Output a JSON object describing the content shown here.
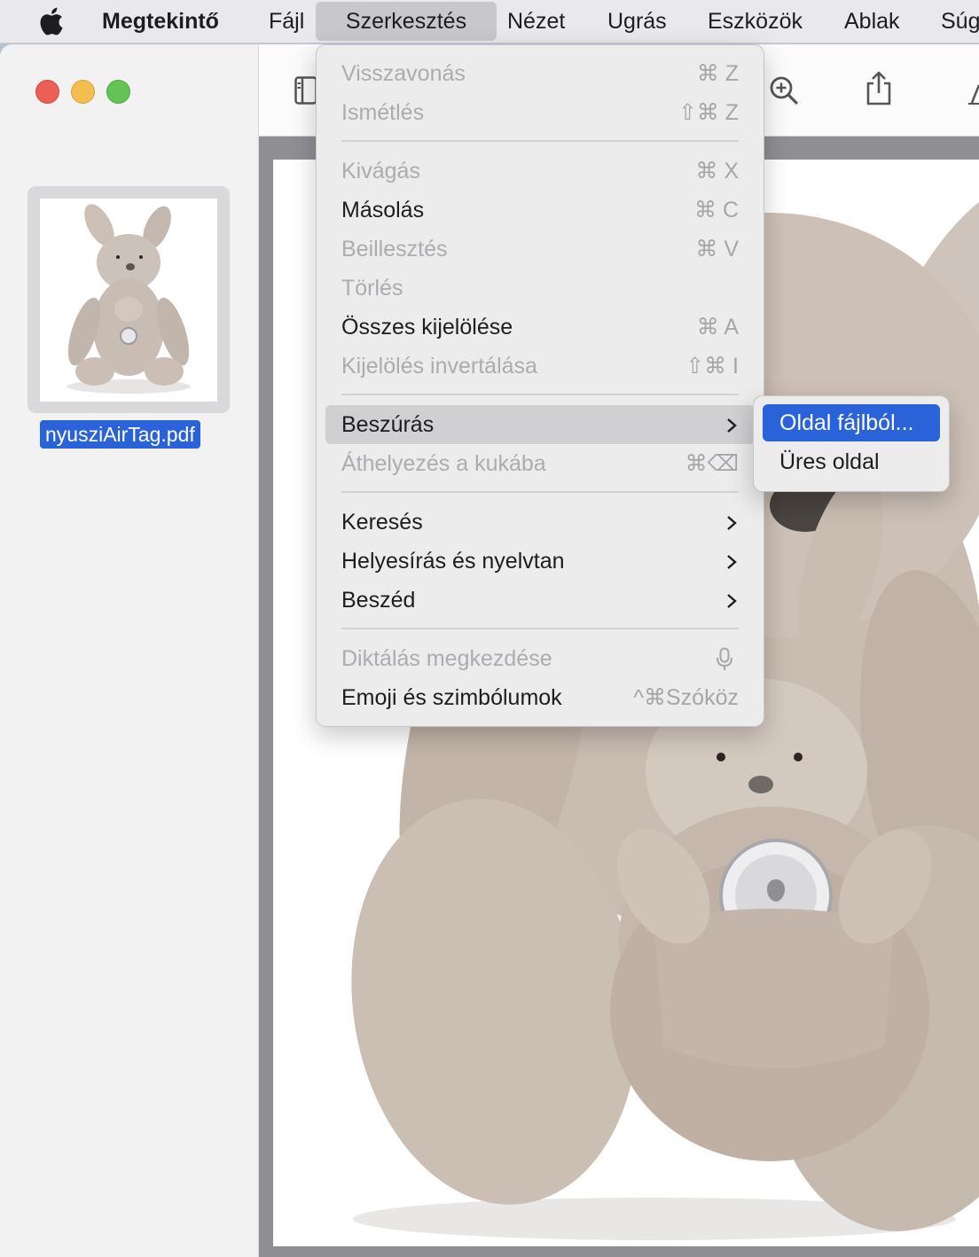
{
  "menubar": {
    "app": "Megtekintő",
    "items": [
      "Fájl",
      "Szerkesztés",
      "Nézet",
      "Ugrás",
      "Eszközök",
      "Ablak",
      "Súg"
    ],
    "active": "Szerkesztés"
  },
  "sidebar": {
    "filename": "nyusziAirTag.pdf"
  },
  "edit_menu": {
    "items": [
      {
        "label": "Visszavonás",
        "shortcut": "⌘ Z",
        "enabled": false
      },
      {
        "label": "Ismétlés",
        "shortcut": "⇧⌘ Z",
        "enabled": false
      },
      {
        "label": "Kivágás",
        "shortcut": "⌘ X",
        "enabled": false
      },
      {
        "label": "Másolás",
        "shortcut": "⌘ C",
        "enabled": true
      },
      {
        "label": "Beillesztés",
        "shortcut": "⌘ V",
        "enabled": false
      },
      {
        "label": "Törlés",
        "shortcut": "",
        "enabled": false
      },
      {
        "label": "Összes kijelölése",
        "shortcut": "⌘ A",
        "enabled": true
      },
      {
        "label": "Kijelölés invertálása",
        "shortcut": "⇧⌘ I",
        "enabled": false
      },
      {
        "label": "Beszúrás",
        "submenu": true,
        "enabled": true,
        "highlighted": true
      },
      {
        "label": "Áthelyezés a kukába",
        "shortcut": "⌘⌫",
        "enabled": false
      },
      {
        "label": "Keresés",
        "submenu": true,
        "enabled": true
      },
      {
        "label": "Helyesírás és nyelvtan",
        "submenu": true,
        "enabled": true
      },
      {
        "label": "Beszéd",
        "submenu": true,
        "enabled": true
      },
      {
        "label": "Diktálás megkezdése",
        "icon": "microphone-icon",
        "enabled": false
      },
      {
        "label": "Emoji és szimbólumok",
        "shortcut": "^⌘Szóköz",
        "enabled": true
      }
    ]
  },
  "insert_submenu": {
    "items": [
      {
        "label": "Oldal fájlból...",
        "selected": true
      },
      {
        "label": "Üres oldal",
        "selected": false
      }
    ]
  },
  "colors": {
    "accent": "#2a63d9",
    "close": "#ec5f57",
    "minimize": "#f4bd4f",
    "zoom": "#61c454"
  }
}
